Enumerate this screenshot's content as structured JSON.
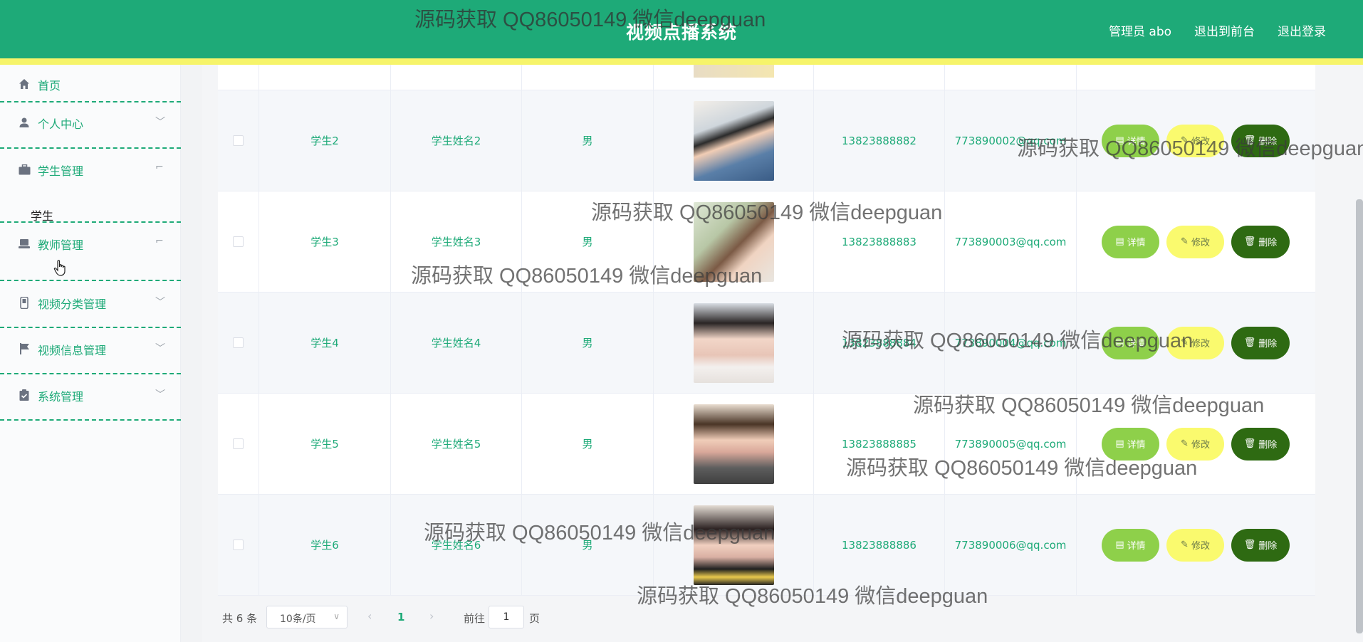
{
  "header": {
    "title": "视频点播系统",
    "admin_label": "管理员 abo",
    "to_front_label": "退出到前台",
    "logout_label": "退出登录",
    "bg_color": "#1eaa78",
    "stripe_color": "#f6f46a"
  },
  "sidebar": {
    "items": [
      {
        "label": "首页",
        "icon": "home-icon"
      },
      {
        "label": "个人中心",
        "icon": "user-icon"
      },
      {
        "label": "学生管理",
        "icon": "briefcase-icon",
        "sub": "学生"
      },
      {
        "label": "教师管理",
        "icon": "laptop-icon"
      },
      {
        "label": "视频分类管理",
        "icon": "phone-icon"
      },
      {
        "label": "视频信息管理",
        "icon": "flag-icon"
      },
      {
        "label": "系统管理",
        "icon": "clipboard-icon"
      }
    ]
  },
  "table": {
    "rows": [
      {
        "account": "学生2",
        "name": "学生姓名2",
        "gender": "男",
        "phone": "13823888882",
        "email": "773890002@qq.com"
      },
      {
        "account": "学生3",
        "name": "学生姓名3",
        "gender": "男",
        "phone": "13823888883",
        "email": "773890003@qq.com"
      },
      {
        "account": "学生4",
        "name": "学生姓名4",
        "gender": "男",
        "phone": "13823888884",
        "email": "773890004@qq.com"
      },
      {
        "account": "学生5",
        "name": "学生姓名5",
        "gender": "男",
        "phone": "13823888885",
        "email": "773890005@qq.com"
      },
      {
        "account": "学生6",
        "name": "学生姓名6",
        "gender": "男",
        "phone": "13823888886",
        "email": "773890006@qq.com"
      }
    ],
    "actions": {
      "detail": "详情",
      "edit": "修改",
      "delete": "删除"
    }
  },
  "pager": {
    "total": "共 6 条",
    "page_size": "10条/页",
    "current_page": "1",
    "goto_label": "前往",
    "goto_value": "1",
    "page_unit": "页"
  },
  "watermark": "源码获取 QQ86050149 微信deepguan"
}
